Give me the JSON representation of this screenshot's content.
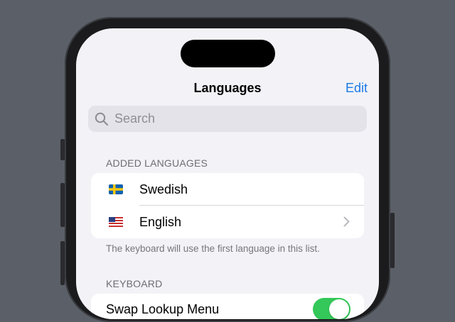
{
  "nav": {
    "title": "Languages",
    "edit_label": "Edit"
  },
  "search": {
    "placeholder": "Search"
  },
  "added_languages": {
    "header": "ADDED LANGUAGES",
    "items": [
      {
        "label": "Swedish",
        "flag": "swedish-flag-icon"
      },
      {
        "label": "English",
        "flag": "us-flag-icon"
      }
    ],
    "footer": "The keyboard will use the first language in this list."
  },
  "keyboard": {
    "header": "KEYBOARD",
    "row_label": "Swap Lookup Menu",
    "toggle_on": true
  },
  "colors": {
    "accent": "#1a7ae6",
    "toggle_on": "#34c759",
    "background": "#f2f2f7"
  }
}
